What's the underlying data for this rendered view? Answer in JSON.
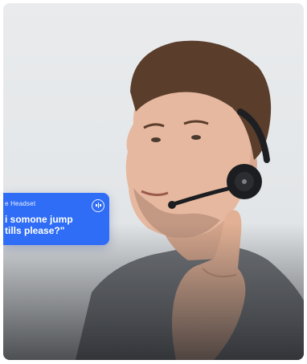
{
  "hero": {
    "bubble": {
      "label": "e Headset",
      "text": "i somone jump\ntills please?\"",
      "icon": "voice-wave-icon"
    }
  },
  "colors": {
    "bubble_bg": "#2f6df6",
    "background": "#e6e8ea"
  }
}
